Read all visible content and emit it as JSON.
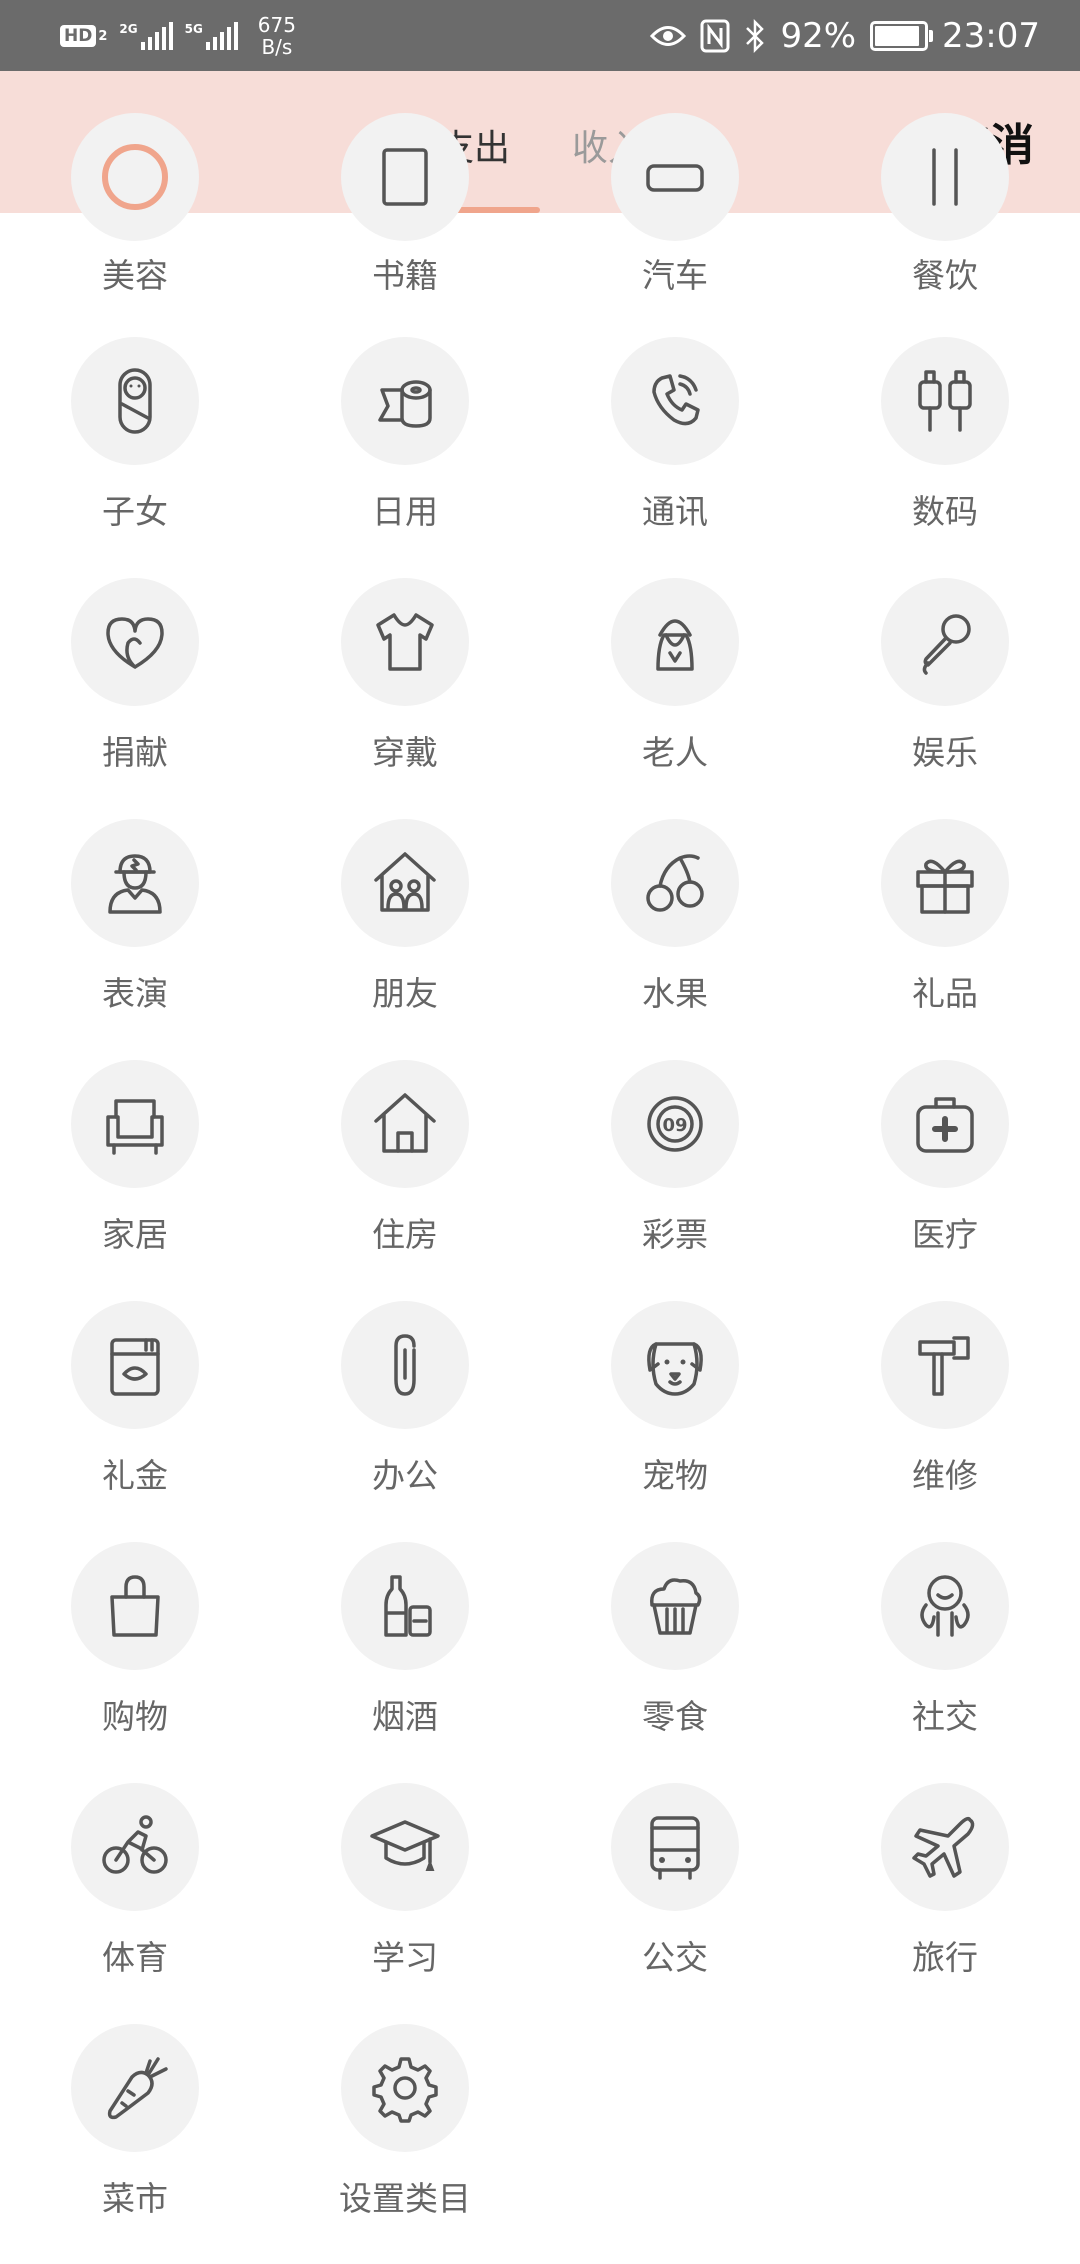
{
  "status_bar": {
    "hd": "HD",
    "hd_sub": "2",
    "sim1": "2G",
    "sim2": "5G",
    "speed_value": "675",
    "speed_unit": "B/s",
    "battery_percent": "92%",
    "time": "23:07",
    "battery_level": 0.92
  },
  "header": {
    "tab_expense": "支出",
    "tab_income": "收入",
    "active_tab": "支出",
    "cancel_label": "取消",
    "background_color": "#f7ddd8",
    "accent_color": "#f0a58c"
  },
  "categories": [
    {
      "label": "美容",
      "icon": "beauty-icon"
    },
    {
      "label": "书籍",
      "icon": "book-icon"
    },
    {
      "label": "汽车",
      "icon": "car-icon"
    },
    {
      "label": "餐饮",
      "icon": "dining-icon"
    },
    {
      "label": "子女",
      "icon": "baby-icon"
    },
    {
      "label": "日用",
      "icon": "tissue-roll-icon"
    },
    {
      "label": "通讯",
      "icon": "phone-icon"
    },
    {
      "label": "数码",
      "icon": "plug-icon"
    },
    {
      "label": "捐献",
      "icon": "heart-icon"
    },
    {
      "label": "穿戴",
      "icon": "tshirt-icon"
    },
    {
      "label": "老人",
      "icon": "elder-icon"
    },
    {
      "label": "娱乐",
      "icon": "microphone-icon"
    },
    {
      "label": "表演",
      "icon": "performer-icon"
    },
    {
      "label": "朋友",
      "icon": "friends-house-icon"
    },
    {
      "label": "水果",
      "icon": "cherry-icon"
    },
    {
      "label": "礼品",
      "icon": "gift-icon"
    },
    {
      "label": "家居",
      "icon": "armchair-icon"
    },
    {
      "label": "住房",
      "icon": "house-icon"
    },
    {
      "label": "彩票",
      "icon": "lottery-ball-icon"
    },
    {
      "label": "医疗",
      "icon": "medical-kit-icon"
    },
    {
      "label": "礼金",
      "icon": "red-envelope-icon"
    },
    {
      "label": "办公",
      "icon": "paperclip-icon"
    },
    {
      "label": "宠物",
      "icon": "dog-icon"
    },
    {
      "label": "维修",
      "icon": "hammer-icon"
    },
    {
      "label": "购物",
      "icon": "shopping-bag-icon"
    },
    {
      "label": "烟酒",
      "icon": "bottle-icon"
    },
    {
      "label": "零食",
      "icon": "cupcake-icon"
    },
    {
      "label": "社交",
      "icon": "social-icon"
    },
    {
      "label": "体育",
      "icon": "cyclist-icon"
    },
    {
      "label": "学习",
      "icon": "graduation-cap-icon"
    },
    {
      "label": "公交",
      "icon": "bus-icon"
    },
    {
      "label": "旅行",
      "icon": "airplane-icon"
    },
    {
      "label": "菜市",
      "icon": "carrot-icon"
    },
    {
      "label": "设置类目",
      "icon": "gear-icon"
    }
  ],
  "lottery_ball_text": "09"
}
